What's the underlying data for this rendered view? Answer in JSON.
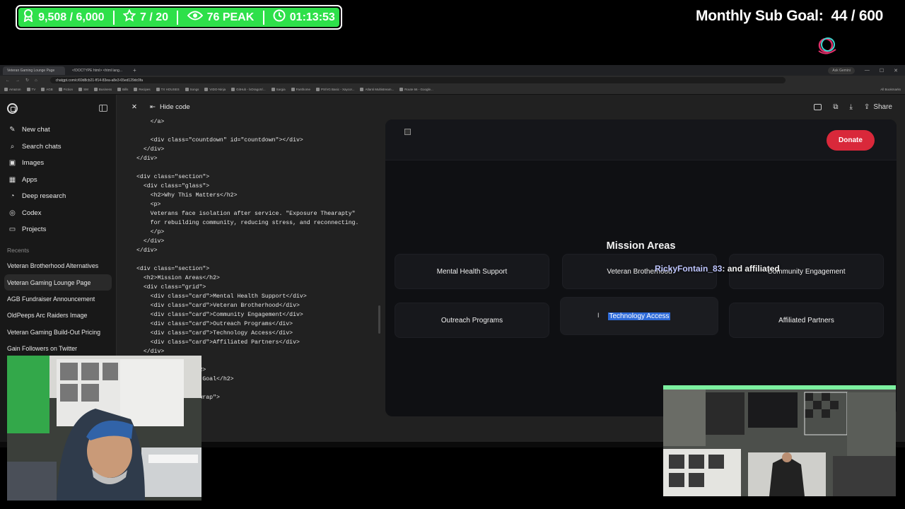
{
  "overlay": {
    "followers": "9,508 / 6,000",
    "stars": "7 / 20",
    "peak": "76 PEAK",
    "timer": "01:13:53",
    "goal_label": "Monthly Sub Goal:",
    "goal_value": "44 / 600"
  },
  "browser": {
    "tabs": [
      "Veteran Gaming Lounge Page",
      "<!DOCTYPE html> <html lang..."
    ],
    "tab_plus": "+",
    "ask": "Ask Gemini",
    "url": "chatgpt.com/c/69d8cb21-ff14-83ea-a8e3-65ed129dc0fa",
    "bookmarks": [
      "Amazon",
      "TV",
      "AGB",
      "Fiction",
      "SM",
      "Business",
      "Bills",
      "Recipes",
      "TX HOUSES",
      "Songs",
      "VIDO-Ninja",
      "GitHub - lxDragoX/...",
      "Sargia",
      "Fanthome",
      "PS/VG Basic - Xaycor...",
      "Atlanti Multistream...",
      "Route 66 - Google..."
    ],
    "all_bookmarks": "All Bookmarks"
  },
  "sidebar": {
    "items": [
      {
        "label": "New chat",
        "icon": "compose-icon"
      },
      {
        "label": "Search chats",
        "icon": "search-icon"
      },
      {
        "label": "Images",
        "icon": "image-icon"
      },
      {
        "label": "Apps",
        "icon": "grid-icon"
      },
      {
        "label": "Deep research",
        "icon": "telescope-icon"
      },
      {
        "label": "Codex",
        "icon": "codex-icon"
      },
      {
        "label": "Projects",
        "icon": "folder-icon"
      }
    ],
    "recents_label": "Recents",
    "chats": [
      "Veteran Brotherhood Alternatives",
      "Veteran Gaming Lounge Page",
      "AGB Fundraiser Announcement",
      "OldPeeps Arc Raiders Image",
      "Veteran Gaming Build-Out Pricing",
      "Gain Followers on Twitter"
    ]
  },
  "code_panel": {
    "hide_label": "Hide code",
    "lines": [
      "    </a>",
      "",
      "    <div class=\"countdown\" id=\"countdown\"></div>",
      "  </div>",
      "</div>",
      "",
      "<div class=\"section\">",
      "  <div class=\"glass\">",
      "    <h2>Why This Matters</h2>",
      "    <p>",
      "    Veterans face isolation after service. \"Exposure Thearapty\"",
      "    for rebuilding community, reducing stress, and reconnecting.",
      "    </p>",
      "  </div>",
      "</div>",
      "",
      "<div class=\"section\">",
      "  <h2>Mission Areas</h2>",
      "  <div class=\"grid\">",
      "    <div class=\"card\">Mental Health Support</div>",
      "    <div class=\"card\">Veteran Brotherhood</div>",
      "    <div class=\"card\">Community Engagement</div>",
      "    <div class=\"card\">Outreach Programs</div>",
      "    <div class=\"card\">Technology Access</div>",
      "    <div class=\"card\">Affiliated Partners</div>",
      "  </div>",
      "",
      "                <h2>",
      "            mpaign Goal</h2>",
      "",
      "            gress-wrap\">"
    ]
  },
  "topbar": {
    "share_label": "Share"
  },
  "preview": {
    "donate_label": "Donate",
    "mission_title": "Mission Areas",
    "cards": [
      "Mental Health Support",
      "Veteran Brotherhood",
      "Community Engagement",
      "Outreach Programs",
      "Technology Access",
      "Affiliated Partners"
    ],
    "chat_user": "RickyFontain_83",
    "chat_message": ": and affiliated"
  }
}
